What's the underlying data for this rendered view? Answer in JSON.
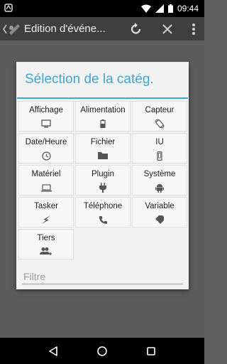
{
  "status_bar": {
    "time": "09:44"
  },
  "action_bar": {
    "title": "Edition d'événe..."
  },
  "dialog": {
    "title": "Sélection de la catég.",
    "categories": [
      {
        "label": "Affichage",
        "icon": "monitor-icon"
      },
      {
        "label": "Alimentation",
        "icon": "battery-icon"
      },
      {
        "label": "Capteur",
        "icon": "rotate-device-icon"
      },
      {
        "label": "Date/Heure",
        "icon": "clock-icon"
      },
      {
        "label": "Fichier",
        "icon": "folder-icon"
      },
      {
        "label": "IU",
        "icon": "phone-icon"
      },
      {
        "label": "Matériel",
        "icon": "laptop-icon"
      },
      {
        "label": "Plugin",
        "icon": "plug-icon"
      },
      {
        "label": "Système",
        "icon": "android-icon"
      },
      {
        "label": "Tasker",
        "icon": "lightning-icon"
      },
      {
        "label": "Téléphone",
        "icon": "handset-icon"
      },
      {
        "label": "Variable",
        "icon": "tag-icon"
      },
      {
        "label": "Tiers",
        "icon": "people-add-icon"
      }
    ],
    "filter_placeholder": "Filtre"
  },
  "colors": {
    "accent": "#38aad9",
    "dialog_bg": "#f2f2f2",
    "scrim": "#5c5c5c"
  }
}
